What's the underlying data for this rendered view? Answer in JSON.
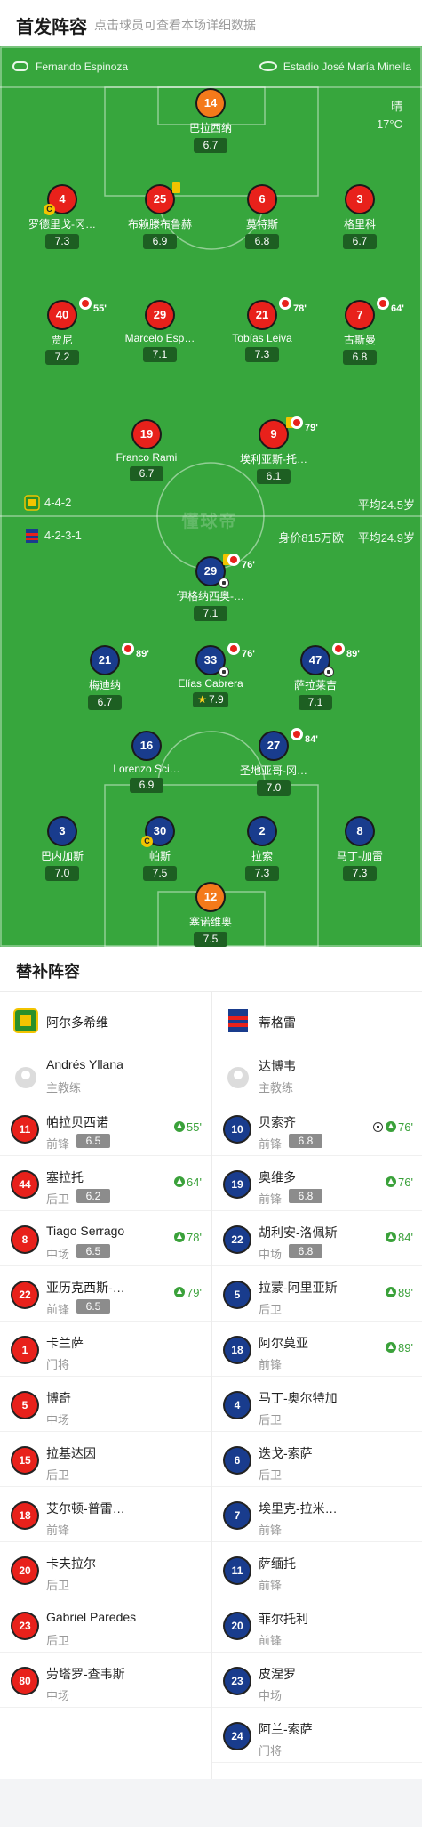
{
  "header": {
    "title": "首发阵容",
    "subtitle": "点击球员可查看本场详细数据"
  },
  "info": {
    "referee": "Fernando Espinoza",
    "stadium": "Estadio José María Minella",
    "weather": "晴",
    "temperature": "17°C",
    "watermark": "懂球帝"
  },
  "home_row": {
    "formation": "4-4-2",
    "avg_label": "平均24.5岁",
    "value": ""
  },
  "away_row": {
    "formation": "4-2-3-1",
    "avg_label": "平均24.9岁",
    "value": "身价815万欧"
  },
  "home_players": [
    {
      "number": "14",
      "name": "巴拉西纳",
      "rating": "6.7",
      "color": "orange"
    },
    {
      "number": "4",
      "name": "罗德里戈-冈…",
      "rating": "7.3",
      "color": "red",
      "captain": "C"
    },
    {
      "number": "25",
      "name": "布赖滕布鲁赫",
      "rating": "6.9",
      "color": "red",
      "yellow": true
    },
    {
      "number": "6",
      "name": "莫特斯",
      "rating": "6.8",
      "color": "red"
    },
    {
      "number": "3",
      "name": "格里科",
      "rating": "6.7",
      "color": "red"
    },
    {
      "number": "40",
      "name": "贾尼",
      "rating": "7.2",
      "color": "red",
      "sub_min": "55'"
    },
    {
      "number": "29",
      "name": "Marcelo Esp…",
      "rating": "7.1",
      "color": "red"
    },
    {
      "number": "21",
      "name": "Tobías Leiva",
      "rating": "7.3",
      "color": "red",
      "sub_min": "78'"
    },
    {
      "number": "7",
      "name": "古斯曼",
      "rating": "6.8",
      "color": "red",
      "sub_min": "64'"
    },
    {
      "number": "19",
      "name": "Franco Rami",
      "rating": "6.7",
      "color": "red"
    },
    {
      "number": "9",
      "name": "埃利亚斯-托…",
      "rating": "6.1",
      "color": "red",
      "yellow": true,
      "sub_min": "79'"
    }
  ],
  "away_players": [
    {
      "number": "29",
      "name": "伊格纳西奥-…",
      "rating": "7.1",
      "color": "blue",
      "yellow": true,
      "sub_min": "76'",
      "goal": true
    },
    {
      "number": "21",
      "name": "梅迪纳",
      "rating": "6.7",
      "color": "blue",
      "sub_min": "89'"
    },
    {
      "number": "33",
      "name": "Elías Cabrera",
      "rating": "7.9",
      "color": "blue",
      "sub_min": "76'",
      "star": true,
      "sub_ball": true
    },
    {
      "number": "47",
      "name": "萨拉莱吉",
      "rating": "7.1",
      "color": "blue",
      "sub_min": "89'",
      "sub_ball": true
    },
    {
      "number": "16",
      "name": "Lorenzo Sci…",
      "rating": "6.9",
      "color": "blue"
    },
    {
      "number": "27",
      "name": "圣地亚哥-冈…",
      "rating": "7.0",
      "color": "blue",
      "sub_min": "84'"
    },
    {
      "number": "3",
      "name": "巴内加斯",
      "rating": "7.0",
      "color": "blue"
    },
    {
      "number": "30",
      "name": "帕斯",
      "rating": "7.5",
      "color": "blue",
      "captain": "C"
    },
    {
      "number": "2",
      "name": "拉索",
      "rating": "7.3",
      "color": "blue"
    },
    {
      "number": "8",
      "name": "马丁-加雷",
      "rating": "7.3",
      "color": "blue"
    },
    {
      "number": "12",
      "name": "塞诺维奥",
      "rating": "7.5",
      "color": "orange"
    }
  ],
  "bench": {
    "title": "替补阵容",
    "home": {
      "team_name": "阿尔多希维",
      "coach_name": "Andrés Yllana",
      "coach_role": "主教练",
      "players": [
        {
          "number": "11",
          "name": "帕拉贝西诺",
          "pos": "前锋",
          "rating": "6.5",
          "sub": "55'"
        },
        {
          "number": "44",
          "name": "塞拉托",
          "pos": "后卫",
          "rating": "6.2",
          "sub": "64'"
        },
        {
          "number": "8",
          "name": "Tiago Serrago",
          "pos": "中场",
          "rating": "6.5",
          "sub": "78'"
        },
        {
          "number": "22",
          "name": "亚历克西斯-…",
          "pos": "前锋",
          "rating": "6.5",
          "sub": "79'"
        },
        {
          "number": "1",
          "name": "卡兰萨",
          "pos": "门将"
        },
        {
          "number": "5",
          "name": "博奇",
          "pos": "中场"
        },
        {
          "number": "15",
          "name": "拉基达因",
          "pos": "后卫"
        },
        {
          "number": "18",
          "name": "艾尔顿-普雷…",
          "pos": "前锋"
        },
        {
          "number": "20",
          "name": "卡夫拉尔",
          "pos": "后卫"
        },
        {
          "number": "23",
          "name": "Gabriel Paredes",
          "pos": "后卫"
        },
        {
          "number": "80",
          "name": "劳塔罗-查韦斯",
          "pos": "中场"
        }
      ]
    },
    "away": {
      "team_name": "蒂格雷",
      "coach_name": "达博韦",
      "coach_role": "主教练",
      "players": [
        {
          "number": "10",
          "name": "贝索齐",
          "pos": "前锋",
          "rating": "6.8",
          "sub": "76'",
          "goal": true
        },
        {
          "number": "19",
          "name": "奥维多",
          "pos": "前锋",
          "rating": "6.8",
          "sub": "76'"
        },
        {
          "number": "22",
          "name": "胡利安-洛佩斯",
          "pos": "中场",
          "rating": "6.8",
          "sub": "84'"
        },
        {
          "number": "5",
          "name": "拉蒙-阿里亚斯",
          "pos": "后卫",
          "sub": "89'"
        },
        {
          "number": "18",
          "name": "阿尔莫亚",
          "pos": "前锋",
          "sub": "89'"
        },
        {
          "number": "4",
          "name": "马丁-奥尔特加",
          "pos": "后卫"
        },
        {
          "number": "6",
          "name": "迭戈-索萨",
          "pos": "后卫"
        },
        {
          "number": "7",
          "name": "埃里克-拉米…",
          "pos": "前锋"
        },
        {
          "number": "11",
          "name": "萨缅托",
          "pos": "前锋"
        },
        {
          "number": "20",
          "name": "菲尔托利",
          "pos": "前锋"
        },
        {
          "number": "23",
          "name": "皮涅罗",
          "pos": "中场"
        },
        {
          "number": "24",
          "name": "阿兰-索萨",
          "pos": "门将"
        }
      ]
    }
  }
}
